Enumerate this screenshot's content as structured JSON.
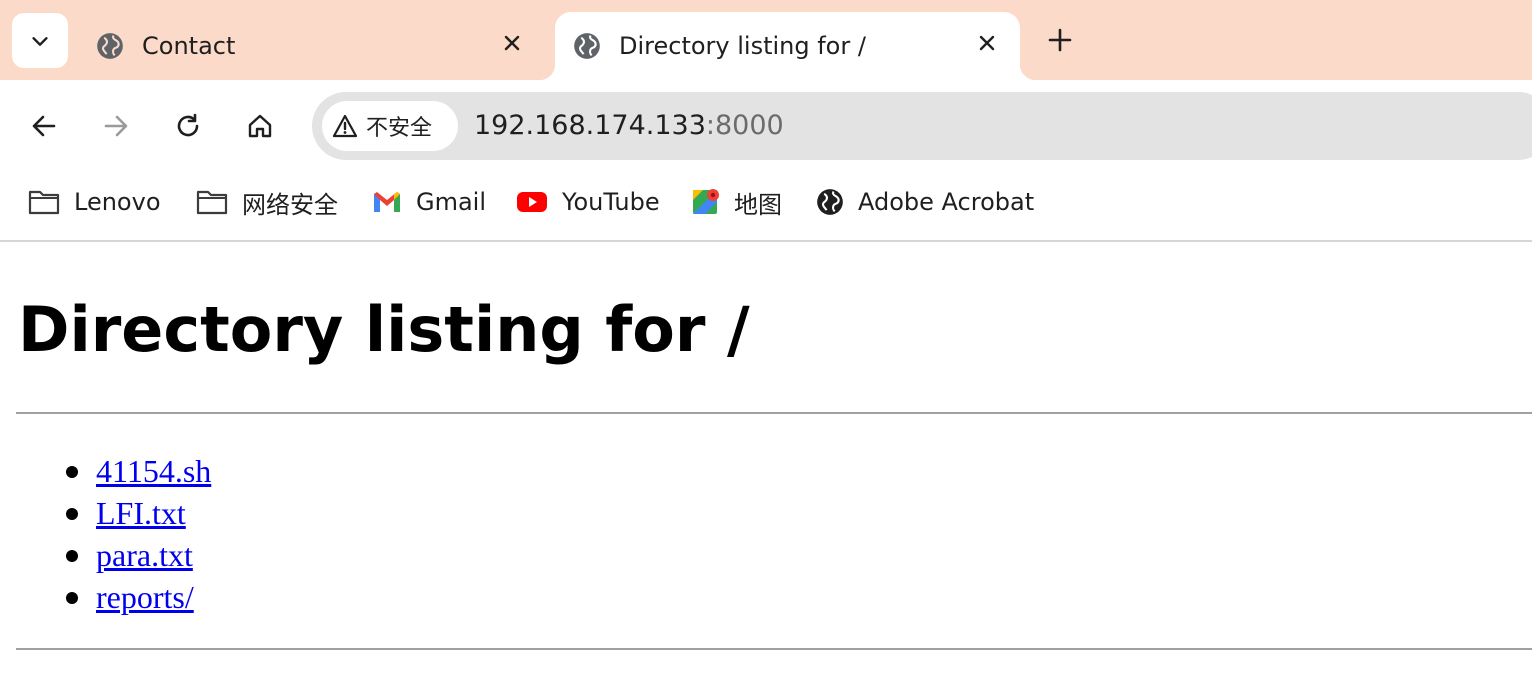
{
  "tabs": [
    {
      "title": "Contact",
      "active": false,
      "icon": "globe-icon"
    },
    {
      "title": "Directory listing for /",
      "active": true,
      "icon": "globe-icon"
    }
  ],
  "toolbar": {
    "security_label": "不安全",
    "url_host": "192.168.174.133",
    "url_port": ":8000"
  },
  "bookmarks": [
    {
      "label": "Lenovo",
      "icon": "folder-icon"
    },
    {
      "label": "网络安全",
      "icon": "folder-icon"
    },
    {
      "label": "Gmail",
      "icon": "gmail-icon"
    },
    {
      "label": "YouTube",
      "icon": "youtube-icon"
    },
    {
      "label": "地图",
      "icon": "maps-icon"
    },
    {
      "label": "Adobe Acrobat",
      "icon": "globe-icon"
    }
  ],
  "page": {
    "heading": "Directory listing for /",
    "files": [
      "41154.sh",
      "LFI.txt",
      "para.txt",
      "reports/"
    ]
  },
  "colors": {
    "tabstrip": "#fcdac9",
    "omnibox": "#e3e3e3",
    "link": "#0000ee"
  }
}
